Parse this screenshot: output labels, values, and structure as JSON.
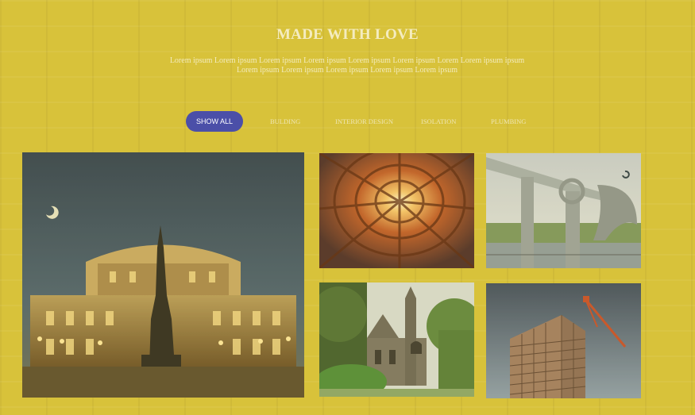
{
  "section": {
    "title": "MADE WITH LOVE",
    "intro": "Lorem ipsum Lorem ipsum Lorem ipsum Lorem ipsum Lorem ipsum Lorem ipsum Lorem Lorem ipsum ipsum Lorem ipsum Lorem ipsum Lorem ipsum Lorem ipsum Lorem ipsum"
  },
  "filters": [
    {
      "label": "SHOW ALL",
      "active": true
    },
    {
      "label": "BULDING",
      "active": false
    },
    {
      "label": "INTERIOR DESIGN",
      "active": false
    },
    {
      "label": "ISOLATION",
      "active": false
    },
    {
      "label": "PLUMBING",
      "active": false
    }
  ],
  "gallery": [
    {
      "name": "opera-house-night-photo"
    },
    {
      "name": "interior-light-well-photo"
    },
    {
      "name": "boat-lift-bridge-photo"
    },
    {
      "name": "gothic-chapel-photo"
    },
    {
      "name": "building-under-construction-photo"
    }
  ],
  "colors": {
    "background": "#d8c23a",
    "active_filter": "#4b4fa8",
    "text": "#f4ecc0"
  }
}
